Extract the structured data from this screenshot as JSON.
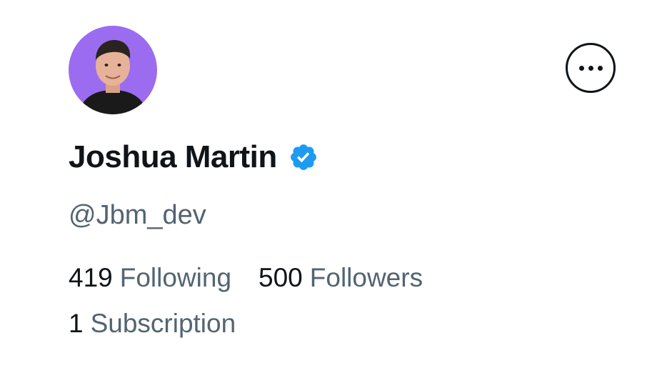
{
  "profile": {
    "display_name": "Joshua Martin",
    "handle": "@Jbm_dev",
    "verified": true,
    "avatar_bg_color": "#9b6cf0",
    "verified_color": "#1d9bf0"
  },
  "stats": {
    "following_count": "419",
    "following_label": "Following",
    "followers_count": "500",
    "followers_label": "Followers",
    "subscriptions_count": "1",
    "subscriptions_label": "Subscription"
  },
  "icons": {
    "more": "more-horizontal-icon",
    "verified": "verified-badge-icon"
  }
}
